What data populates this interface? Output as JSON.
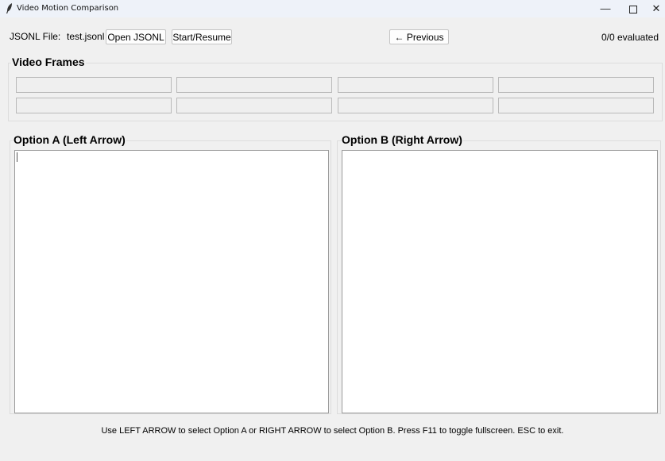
{
  "window": {
    "title": "Video Motion Comparison",
    "minimize_glyph": "—",
    "close_glyph": "✕"
  },
  "toolbar": {
    "file_label": "JSONL File:",
    "file_name": "test.jsonl",
    "open_button": "Open JSONL",
    "start_button": "Start/Resume",
    "previous_button": "← Previous",
    "progress_text": "0/0 evaluated"
  },
  "video_frames": {
    "title": "Video Frames",
    "slot_count": 8
  },
  "option_a": {
    "title": "Option A (Left Arrow)",
    "content": ""
  },
  "option_b": {
    "title": "Option B (Right Arrow)",
    "content": ""
  },
  "footer": {
    "instructions": "Use LEFT ARROW to select Option A or RIGHT ARROW to select Option B. Press F11 to toggle fullscreen. ESC to exit."
  },
  "colors": {
    "window_bg": "#f0f0f0",
    "titlebar_bg": "#eef2f9",
    "text_area_bg": "#ffffff"
  }
}
